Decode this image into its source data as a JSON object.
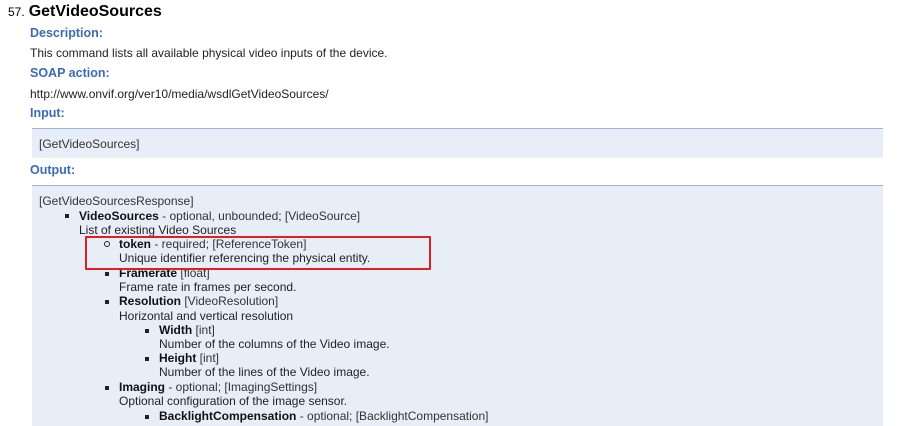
{
  "operation": {
    "number": "57.",
    "name": "GetVideoSources"
  },
  "description": {
    "label": "Description:",
    "text": "This command lists all available physical video inputs of the device."
  },
  "soap_action": {
    "label": "SOAP action:",
    "url": "http://www.onvif.org/ver10/media/wsdlGetVideoSources/"
  },
  "input": {
    "label": "Input:",
    "message": "[GetVideoSources]"
  },
  "output": {
    "label": "Output:",
    "message": "[GetVideoSourcesResponse]",
    "video_sources": {
      "name": "VideoSources",
      "meta": " - optional, unbounded; [VideoSource]",
      "desc": "List of existing Video Sources",
      "token": {
        "name": "token",
        "meta": " - required; [ReferenceToken]",
        "desc": "Unique identifier referencing the physical entity."
      },
      "framerate": {
        "name": "Framerate",
        "meta": " [float]",
        "desc": "Frame rate in frames per second."
      },
      "resolution": {
        "name": "Resolution",
        "meta": " [VideoResolution]",
        "desc": "Horizontal and vertical resolution",
        "width": {
          "name": "Width",
          "meta": " [int]",
          "desc": "Number of the columns of the Video image."
        },
        "height": {
          "name": "Height",
          "meta": " [int]",
          "desc": "Number of the lines of the Video image."
        }
      },
      "imaging": {
        "name": "Imaging",
        "meta": " - optional; [ImagingSettings]",
        "desc": "Optional configuration of the image sensor.",
        "backlight": {
          "name": "BacklightCompensation",
          "meta": " - optional; [BacklightCompensation]"
        }
      }
    }
  },
  "colors": {
    "label_blue": "#3a6cb5",
    "box_background": "#e8eef8",
    "box_border": "#9eb3d4",
    "highlight_red": "#e02020"
  }
}
